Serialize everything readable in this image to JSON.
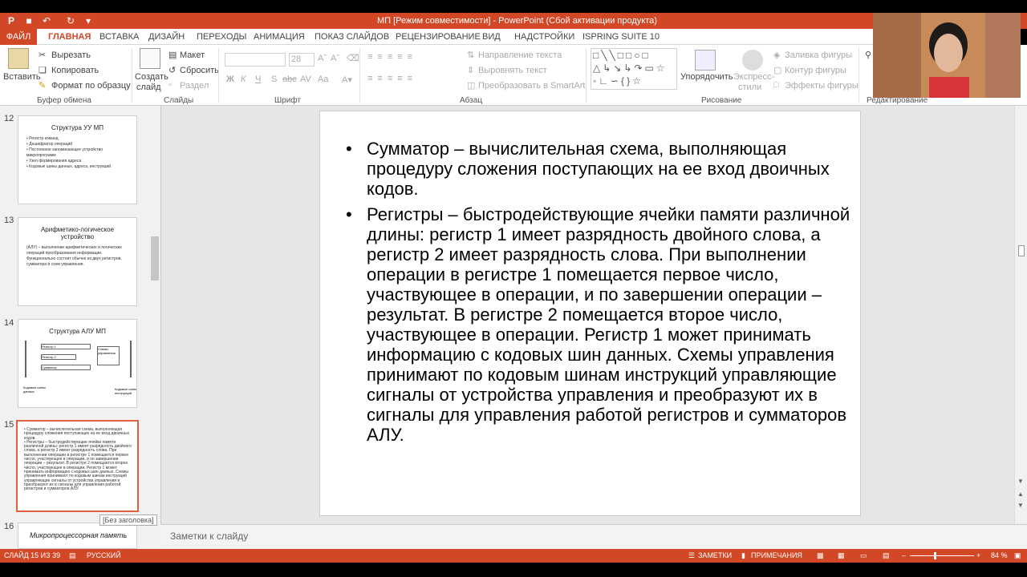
{
  "window": {
    "title": "МП [Режим совместимости] - PowerPoint (Сбой активации продукта)"
  },
  "tabs": [
    "ФАЙЛ",
    "ГЛАВНАЯ",
    "ВСТАВКА",
    "ДИЗАЙН",
    "ПЕРЕХОДЫ",
    "АНИМАЦИЯ",
    "ПОКАЗ СЛАЙДОВ",
    "РЕЦЕНЗИРОВАНИЕ",
    "ВИД",
    "НАДСТРОЙКИ",
    "ISPRING SUITE 10"
  ],
  "ribbon": {
    "clipboard": {
      "paste": "Вставить",
      "cut": "Вырезать",
      "copy": "Копировать",
      "format_painter": "Формат по образцу",
      "group": "Буфер обмена"
    },
    "slides": {
      "new_slide_1": "Создать",
      "new_slide_2": "слайд",
      "layout": "Макет",
      "reset": "Сбросить",
      "section": "Раздел",
      "group": "Слайды"
    },
    "font": {
      "size": "28",
      "bold": "Ж",
      "italic": "К",
      "underline": "Ч",
      "shadow": "S",
      "strike": "abc",
      "spacing": "AV",
      "case": "Aa",
      "group": "Шрифт"
    },
    "paragraph": {
      "text_direction": "Направление текста",
      "align_text": "Выровнять текст",
      "smartart": "Преобразовать в SmartArt",
      "group": "Абзац"
    },
    "drawing": {
      "arrange": "Упорядочить",
      "quick_styles_1": "Экспресс-",
      "quick_styles_2": "стили",
      "fill": "Заливка фигуры",
      "outline": "Контур фигуры",
      "effects": "Эффекты фигуры",
      "group": "Рисование"
    },
    "editing": {
      "group": "Редактирование"
    }
  },
  "thumbnails": [
    {
      "num": "12",
      "title": "Структура УУ МП",
      "items": [
        "Регистр команд",
        "Дешифратор операций",
        "Постоянное запоминающее устройство микропрограмм",
        "Узел формирования адреса",
        "Кодовые шины данных, адреса, инструкций"
      ]
    },
    {
      "num": "13",
      "title": "Арифметико-логическое устройство",
      "body": "(АЛУ) – выполнение арифметических и логических операций преобразования информации. Функционально состоит обычно из двух регистров, сумматора и схем управления."
    },
    {
      "num": "14",
      "title": "Структура АЛУ МП",
      "labels": [
        "Регистр 1",
        "Регистр 2",
        "Сумматор",
        "Схемы управления",
        "Кодовые шины данных",
        "Кодовые шины инструкций"
      ]
    },
    {
      "num": "15",
      "items": [
        "Сумматор – вычислительная схема, выполняющая процедуру сложения поступающих на ее вход двоичных кодов.",
        "Регистры – быстродействующие ячейки памяти различной длины: регистр 1 имеет разрядность двойного слова, а регистр 2 имеет разрядность слова. При выполнении операции в регистре 1 помещается первое число, участвующее в операции, и по завершении операции – результат. В регистре 2 помещается второе число, участвующее в операции. Регистр 1 может принимать информацию с кодовых шин данных. Схемы управления принимают по кодовым шинам инструкций управляющие сигналы от устройства управления и преобразуют их в сигналы для управления работой регистров и сумматоров АЛУ."
      ]
    },
    {
      "num": "16",
      "title": "Микропроцессорная память"
    }
  ],
  "tooltip": "[Без заголовка]",
  "slide": {
    "bullets": [
      "Сумматор – вычислительная схема, выполняющая процедуру сложения поступающих на ее вход двоичных кодов.",
      "Регистры – быстродействующие ячейки памяти различной длины: регистр 1 имеет разрядность двойного слова, а регистр 2 имеет разрядность слова. При выполнении операции в регистре 1 помещается первое число, участвующее в операции, и по завершении операции – результат. В регистре 2 помещается второе число, участвующее в операции. Регистр 1 может принимать информацию с кодовых шин данных. Схемы управления принимают по кодовым шинам инструкций управляющие сигналы от устройства управления и преобразуют их в сигналы для управления работой регистров и сумматоров АЛУ."
    ]
  },
  "notes": {
    "placeholder": "Заметки к слайду"
  },
  "status": {
    "slide": "СЛАЙД 15 ИЗ 39",
    "language": "РУССКИЙ",
    "notes": "ЗАМЕТКИ",
    "comments": "ПРИМЕЧАНИЯ",
    "zoom": "84 %"
  },
  "colors": {
    "accent": "#d24726"
  }
}
